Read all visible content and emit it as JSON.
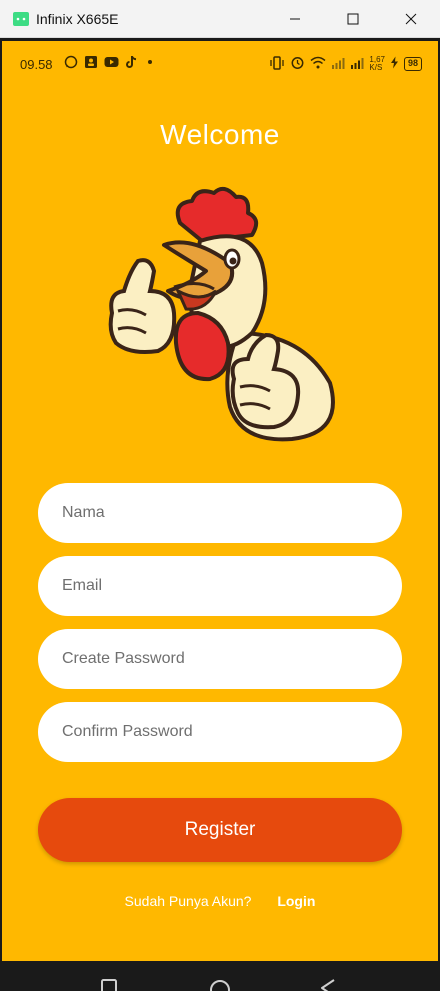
{
  "window": {
    "title": "Infinix X665E"
  },
  "status_bar": {
    "time": "09.58",
    "left_icons": [
      "whatsapp-icon",
      "contact-card-icon",
      "youtube-icon",
      "tiktok-icon",
      "dot-icon"
    ],
    "right_icons": [
      "vibrate-icon",
      "alarm-icon",
      "wifi-icon",
      "signal-icon",
      "signal-icon",
      "charging-icon"
    ],
    "net_speed": "1,67",
    "net_unit": "K/S",
    "battery": "98"
  },
  "screen": {
    "title": "Welcome",
    "background_color": "#FFB800",
    "accent_color": "#E64A0D"
  },
  "form": {
    "name_placeholder": "Nama",
    "email_placeholder": "Email",
    "password_placeholder": "Create Password",
    "confirm_placeholder": "Confirm Password",
    "register_label": "Register"
  },
  "footer": {
    "question": "Sudah Punya Akun?",
    "login_label": "Login"
  },
  "nav": [
    "recents-icon",
    "home-icon",
    "back-icon"
  ]
}
